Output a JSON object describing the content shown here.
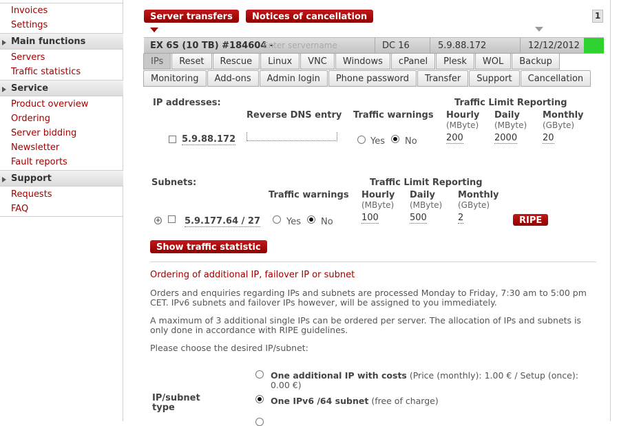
{
  "sidebar": {
    "top_links": [
      "Invoices",
      "Settings"
    ],
    "sections": [
      {
        "title": "Main functions",
        "items": [
          "Servers",
          "Traffic statistics"
        ]
      },
      {
        "title": "Service",
        "items": [
          "Product overview",
          "Ordering",
          "Server bidding",
          "Newsletter",
          "Fault reports"
        ]
      },
      {
        "title": "Support",
        "items": [
          "Requests",
          "FAQ"
        ]
      }
    ]
  },
  "header": {
    "server_transfers": "Server transfers",
    "notices_of_cancellation": "Notices of cancellation",
    "page_number": "1"
  },
  "server": {
    "name": "EX 6S (10 TB) #184604 -",
    "name_placeholder": "Enter servername",
    "datacenter": "DC 16",
    "ip": "5.9.88.172",
    "date": "12/12/2012",
    "status_color": "#2fd22f"
  },
  "tabs_row1": [
    "IPs",
    "Reset",
    "Rescue",
    "Linux",
    "VNC",
    "Windows",
    "cPanel",
    "Plesk",
    "WOL",
    "Backup"
  ],
  "tabs_row2": [
    "Monitoring",
    "Add-ons",
    "Admin login",
    "Phone password",
    "Transfer",
    "Support",
    "Cancellation"
  ],
  "ip_section": {
    "heading": "IP addresses:",
    "col_reverse_dns": "Reverse DNS entry",
    "col_traffic_warnings": "Traffic warnings",
    "col_traffic_limit": "Traffic Limit Reporting",
    "hourly": "Hourly",
    "hourly_unit": "(MByte)",
    "daily": "Daily",
    "daily_unit": "(MByte)",
    "monthly": "Monthly",
    "monthly_unit": "(GByte)",
    "ip": "5.9.88.172",
    "yes": "Yes",
    "no": "No",
    "hourly_value": "200",
    "daily_value": "2000",
    "monthly_value": "20"
  },
  "subnet_section": {
    "heading": "Subnets:",
    "col_traffic_warnings": "Traffic warnings",
    "col_traffic_limit": "Traffic Limit Reporting",
    "hourly": "Hourly",
    "hourly_unit": "(MByte)",
    "daily": "Daily",
    "daily_unit": "(MByte)",
    "monthly": "Monthly",
    "monthly_unit": "(GByte)",
    "subnet": "5.9.177.64 / 27",
    "yes": "Yes",
    "no": "No",
    "hourly_value": "100",
    "daily_value": "500",
    "monthly_value": "2",
    "ripe_button": "RIPE"
  },
  "show_traffic_button": "Show traffic statistic",
  "ordering": {
    "title": "Ordering of additional IP, failover IP or subnet",
    "para1": "Orders and enquiries regarding IPs and subnets are processed Monday to Friday, 7:30 am to 5:00 pm CET. IPv6 subnets and failover IPs however, will be assigned to you immediately.",
    "para2": "A maximum of 3 additional single IPs can be ordered per server. The allocation of IPs and subnets is only done in accordance with RIPE guidelines.",
    "para3": "Please choose the desired IP/subnet:",
    "type_label": "IP/subnet type",
    "option1_bold": "One additional IP with costs",
    "option1_rest": "(Price (monthly): 1.00 € / Setup (once): 0.00 €)",
    "option2_bold": "One IPv6 /64 subnet",
    "option2_rest": "(free of charge)"
  }
}
